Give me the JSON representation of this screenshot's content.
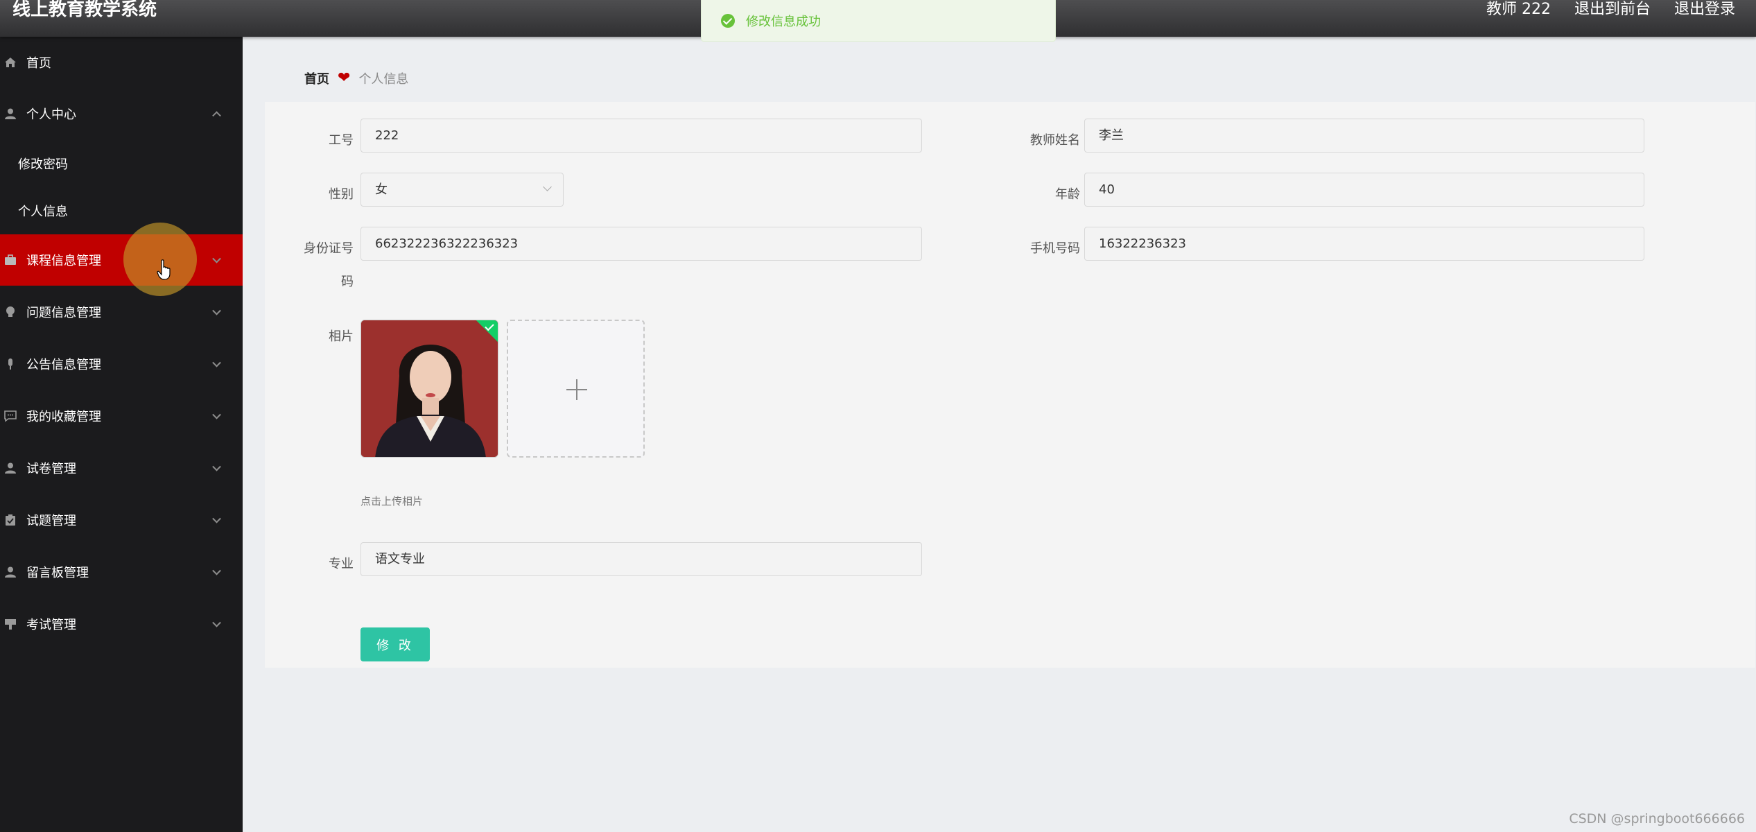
{
  "header": {
    "app_title": "线上教育教学系统",
    "user_label": "教师 222",
    "back_front_label": "退出到前台",
    "logout_label": "退出登录"
  },
  "toast": {
    "message": "修改信息成功"
  },
  "sidebar": {
    "items": [
      {
        "label": "首页",
        "icon": "home-icon"
      },
      {
        "label": "个人中心",
        "icon": "user-icon",
        "expanded": true
      },
      {
        "label": "课程信息管理",
        "icon": "briefcase-icon",
        "active": true
      },
      {
        "label": "问题信息管理",
        "icon": "bulb-icon"
      },
      {
        "label": "公告信息管理",
        "icon": "microphone-icon"
      },
      {
        "label": "我的收藏管理",
        "icon": "chat-icon"
      },
      {
        "label": "试卷管理",
        "icon": "user-icon"
      },
      {
        "label": "试题管理",
        "icon": "clipboard-icon"
      },
      {
        "label": "留言板管理",
        "icon": "user-icon"
      },
      {
        "label": "考试管理",
        "icon": "podium-icon"
      }
    ],
    "sub_items": [
      {
        "label": "修改密码"
      },
      {
        "label": "个人信息"
      }
    ]
  },
  "breadcrumb": {
    "home": "首页",
    "current": "个人信息"
  },
  "form": {
    "job_no": {
      "label": "工号",
      "value": "222"
    },
    "teacher_name": {
      "label": "教师姓名",
      "value": "李兰"
    },
    "gender": {
      "label": "性别",
      "value": "女"
    },
    "age": {
      "label": "年龄",
      "value": "40"
    },
    "id_card": {
      "label_line1": "身份证号",
      "label_line2": "码",
      "value": "662322236322236323"
    },
    "phone": {
      "label": "手机号码",
      "value": "16322236323"
    },
    "photo": {
      "label": "相片",
      "hint": "点击上传相片"
    },
    "major": {
      "label": "专业",
      "value": "语文专业"
    },
    "submit_label": "修 改"
  },
  "watermark": "CSDN @springboot666666",
  "colors": {
    "active_menu": "#c00000",
    "submit": "#2ec4a4",
    "success": "#67c23a"
  }
}
